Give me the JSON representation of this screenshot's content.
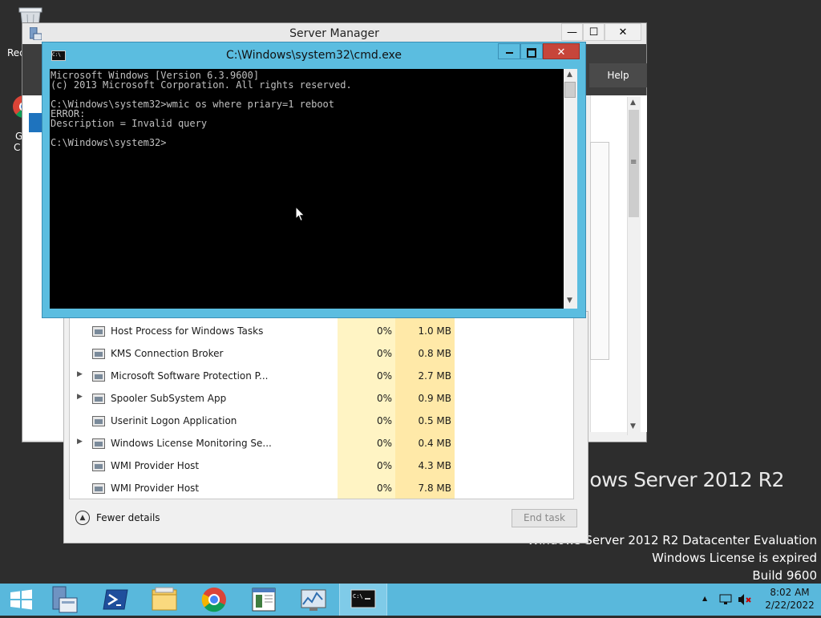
{
  "desktop": {
    "recycle_label_fragment": "Rec",
    "chrome_label_fragment_1": "G",
    "chrome_label_fragment_2": "C",
    "watermark_brand": "dows Server 2012 R2",
    "watermark_line1": "Windows Server 2012 R2 Datacenter Evaluation",
    "watermark_line2": "Windows License is expired",
    "watermark_line3": "Build 9600"
  },
  "server_manager": {
    "title": "Server Manager",
    "help_label": "Help",
    "minimize": "—",
    "maximize": "☐",
    "close": "✕"
  },
  "task_manager": {
    "processes": [
      {
        "name": "Host Process for Windows Tasks",
        "cpu": "0%",
        "memory": "1.0 MB",
        "expandable": false,
        "icon": "app-icon"
      },
      {
        "name": "KMS Connection Broker",
        "cpu": "0%",
        "memory": "0.8 MB",
        "expandable": false,
        "icon": "app-icon"
      },
      {
        "name": "Microsoft Software Protection P...",
        "cpu": "0%",
        "memory": "2.7 MB",
        "expandable": true,
        "icon": "app-icon"
      },
      {
        "name": "Spooler SubSystem App",
        "cpu": "0%",
        "memory": "0.9 MB",
        "expandable": true,
        "icon": "printer-icon"
      },
      {
        "name": "Userinit Logon Application",
        "cpu": "0%",
        "memory": "0.5 MB",
        "expandable": false,
        "icon": "app-icon"
      },
      {
        "name": "Windows License Monitoring Se...",
        "cpu": "0%",
        "memory": "0.4 MB",
        "expandable": true,
        "icon": "app-icon"
      },
      {
        "name": "WMI Provider Host",
        "cpu": "0%",
        "memory": "4.3 MB",
        "expandable": false,
        "icon": "gear-app-icon"
      },
      {
        "name": "WMI Provider Host",
        "cpu": "0%",
        "memory": "7.8 MB",
        "expandable": false,
        "icon": "gear-app-icon"
      }
    ],
    "fewer_details": "Fewer details",
    "end_task": "End task"
  },
  "cmd": {
    "title": "C:\\Windows\\system32\\cmd.exe",
    "icon_text": "C:\\",
    "lines": [
      "Microsoft Windows [Version 6.3.9600]",
      "(c) 2013 Microsoft Corporation. All rights reserved.",
      "",
      "C:\\Windows\\system32>wmic os where priary=1 reboot",
      "ERROR:",
      "Description = Invalid query",
      "",
      "C:\\Windows\\system32>"
    ]
  },
  "taskbar": {
    "apps": [
      "start-icon",
      "server-manager-icon",
      "powershell-icon",
      "file-explorer-icon",
      "chrome-icon",
      "notepad-icon",
      "performance-monitor-icon",
      "cmd-icon"
    ],
    "time": "8:02 AM",
    "date": "2/22/2022",
    "show_hidden": "▲"
  },
  "colors": {
    "taskbar": "#59b8dc",
    "cmd_frame": "#5bbde0",
    "close_button": "#c7453a",
    "cpu_highlight": "#fff4c4",
    "memory_highlight": "#ffe9a8"
  }
}
